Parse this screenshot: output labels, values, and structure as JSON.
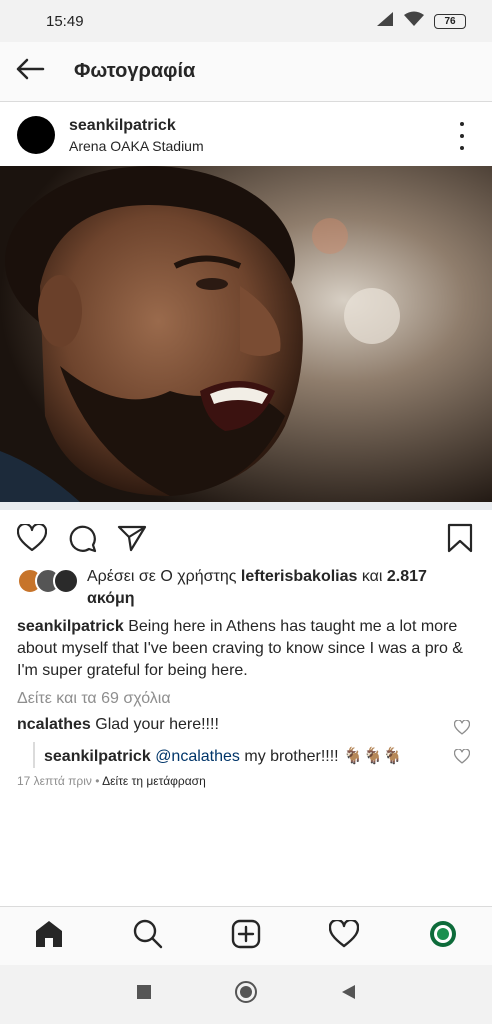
{
  "status": {
    "time": "15:49",
    "battery": "76",
    "icons": [
      "signal-icon",
      "wifi-icon",
      "battery-icon"
    ]
  },
  "header": {
    "title": "Φωτογραφία",
    "back_icon": "back-arrow-icon"
  },
  "post": {
    "username": "seankilpatrick",
    "location": "Arena OAKA Stadium",
    "more_icon": "more-vertical-icon"
  },
  "likes": {
    "prefix": "Αρέσει σε Ο χρήστης ",
    "user": "lefterisbakolias",
    "middle": " και ",
    "count": "2.817 ακόμη"
  },
  "caption": {
    "username": "seankilpatrick",
    "text": "Being here in Athens has taught me a lot more about myself that I've been craving to know since I was a pro & I'm super grateful for being here."
  },
  "view_comments": "Δείτε και τα 69 σχόλια",
  "comments": [
    {
      "username": "ncalathes",
      "text": "Glad your here!!!!"
    },
    {
      "username": "seankilpatrick",
      "mention": "@ncalathes",
      "text": " my brother!!!! 🐐🐐🐐"
    }
  ],
  "meta": {
    "time": "17 λεπτά πριν",
    "separator": " • ",
    "translate": "Δείτε τη μετάφραση"
  },
  "colors": {
    "accent": "#003569",
    "muted": "#8e8e8e",
    "text": "#262626"
  }
}
